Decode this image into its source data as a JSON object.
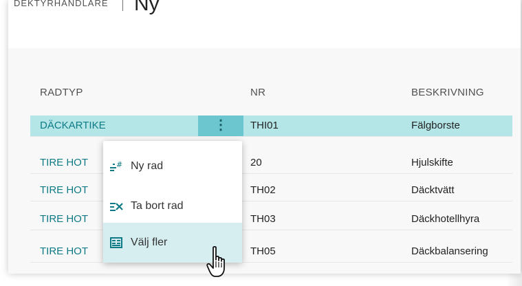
{
  "header": {
    "caption": "DEKTYRHANDLARE",
    "title": "Ny"
  },
  "columns": {
    "type": "RADTYP",
    "nr": "NR",
    "description": "BESKRIVNING"
  },
  "rows": [
    {
      "type": "DÄCKARTIKE",
      "nr": "THI01",
      "description": "Fälgborste",
      "selected": true
    },
    {
      "type": "TIRE HOT",
      "nr": "20",
      "description": "Hjulskifte",
      "selected": false
    },
    {
      "type": "TIRE HOT",
      "nr": "TH02",
      "description": "Däcktvätt",
      "selected": false
    },
    {
      "type": "TIRE HOT",
      "nr": "TH03",
      "description": "Däckhotellhyra",
      "selected": false
    },
    {
      "type": "TIRE HOT",
      "nr": "TH05",
      "description": "Däckbalansering",
      "selected": false
    }
  ],
  "row_menu_button": {
    "glyph": "⋮",
    "icon": "more-vertical-icon"
  },
  "context_menu": {
    "items": [
      {
        "label": "Ny rad",
        "icon": "new-row-icon"
      },
      {
        "label": "Ta bort rad",
        "icon": "delete-row-icon"
      },
      {
        "label": "Välj fler",
        "icon": "select-multiple-icon",
        "hovered": true
      }
    ]
  },
  "colors": {
    "accent": "#0d7a85",
    "selected_row": "#b4e6e8",
    "menu_button": "#6cc6cf",
    "menu_hover": "#d6eef0"
  }
}
